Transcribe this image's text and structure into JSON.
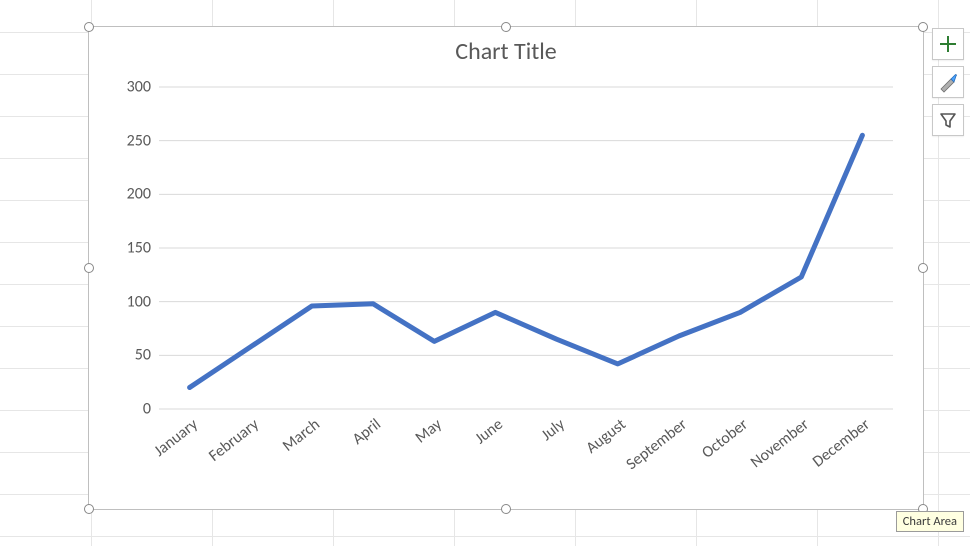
{
  "chart_data": {
    "type": "line",
    "title": "Chart Title",
    "categories": [
      "January",
      "February",
      "March",
      "April",
      "May",
      "June",
      "July",
      "August",
      "September",
      "October",
      "November",
      "December"
    ],
    "values": [
      20,
      58,
      96,
      98,
      63,
      90,
      65,
      42,
      68,
      90,
      123,
      255
    ],
    "ylim": [
      0,
      300
    ],
    "ystep": 50,
    "y_ticks": [
      0,
      50,
      100,
      150,
      200,
      250,
      300
    ],
    "line_color": "#4472c4"
  },
  "tooltip_text": "Chart Area",
  "side_buttons": {
    "add": "chart-elements-button",
    "style": "chart-styles-button",
    "filter": "chart-filters-button"
  }
}
